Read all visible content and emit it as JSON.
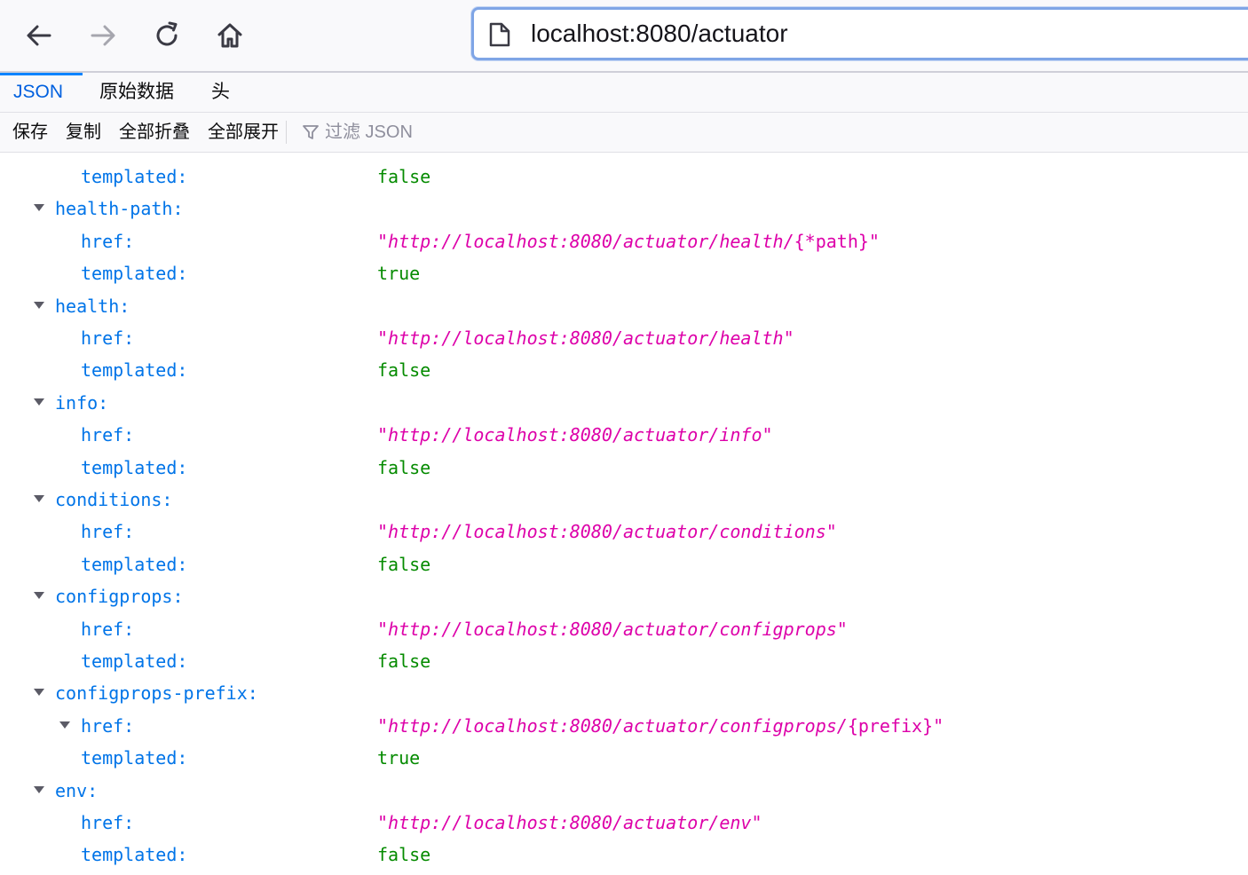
{
  "browser": {
    "url": "localhost:8080/actuator",
    "buttons": {
      "back": "back-icon",
      "forward": "forward-icon",
      "reload": "reload-icon",
      "home": "home-icon"
    }
  },
  "tabs": [
    {
      "label": "JSON",
      "active": true
    },
    {
      "label": "原始数据",
      "active": false
    },
    {
      "label": "头",
      "active": false
    }
  ],
  "toolbar": {
    "save": "保存",
    "copy": "复制",
    "collapse_all": "全部折叠",
    "expand_all": "全部展开",
    "filter_placeholder": "过滤 JSON"
  },
  "colors": {
    "key": "#0074e8",
    "string": "#dd00a9",
    "boolean": "#058b00",
    "tab_active": "#0060df",
    "url_focus": "#7fa5e6"
  },
  "rows": [
    {
      "key": "templated:",
      "value": "false"
    },
    {
      "key": "health-path:"
    },
    {
      "key": "href:",
      "value_prefix": "http://localhost:8080/actuator/health/",
      "value_suffix": "{*path}"
    },
    {
      "key": "templated:",
      "value": "true"
    },
    {
      "key": "health:"
    },
    {
      "key": "href:",
      "value_prefix": "http://localhost:8080/actuator/health",
      "value_suffix": ""
    },
    {
      "key": "templated:",
      "value": "false"
    },
    {
      "key": "info:"
    },
    {
      "key": "href:",
      "value_prefix": "http://localhost:8080/actuator/info",
      "value_suffix": ""
    },
    {
      "key": "templated:",
      "value": "false"
    },
    {
      "key": "conditions:"
    },
    {
      "key": "href:",
      "value_prefix": "http://localhost:8080/actuator/conditions",
      "value_suffix": ""
    },
    {
      "key": "templated:",
      "value": "false"
    },
    {
      "key": "configprops:"
    },
    {
      "key": "href:",
      "value_prefix": "http://localhost:8080/actuator/configprops",
      "value_suffix": ""
    },
    {
      "key": "templated:",
      "value": "false"
    },
    {
      "key": "configprops-prefix:"
    },
    {
      "key": "href:",
      "value_prefix": "http://localhost:8080/actuator/configprops/",
      "value_suffix": "{prefix}"
    },
    {
      "key": "templated:",
      "value": "true"
    },
    {
      "key": "env:"
    },
    {
      "key": "href:",
      "value_prefix": "http://localhost:8080/actuator/env",
      "value_suffix": ""
    },
    {
      "key": "templated:",
      "value": "false"
    }
  ]
}
